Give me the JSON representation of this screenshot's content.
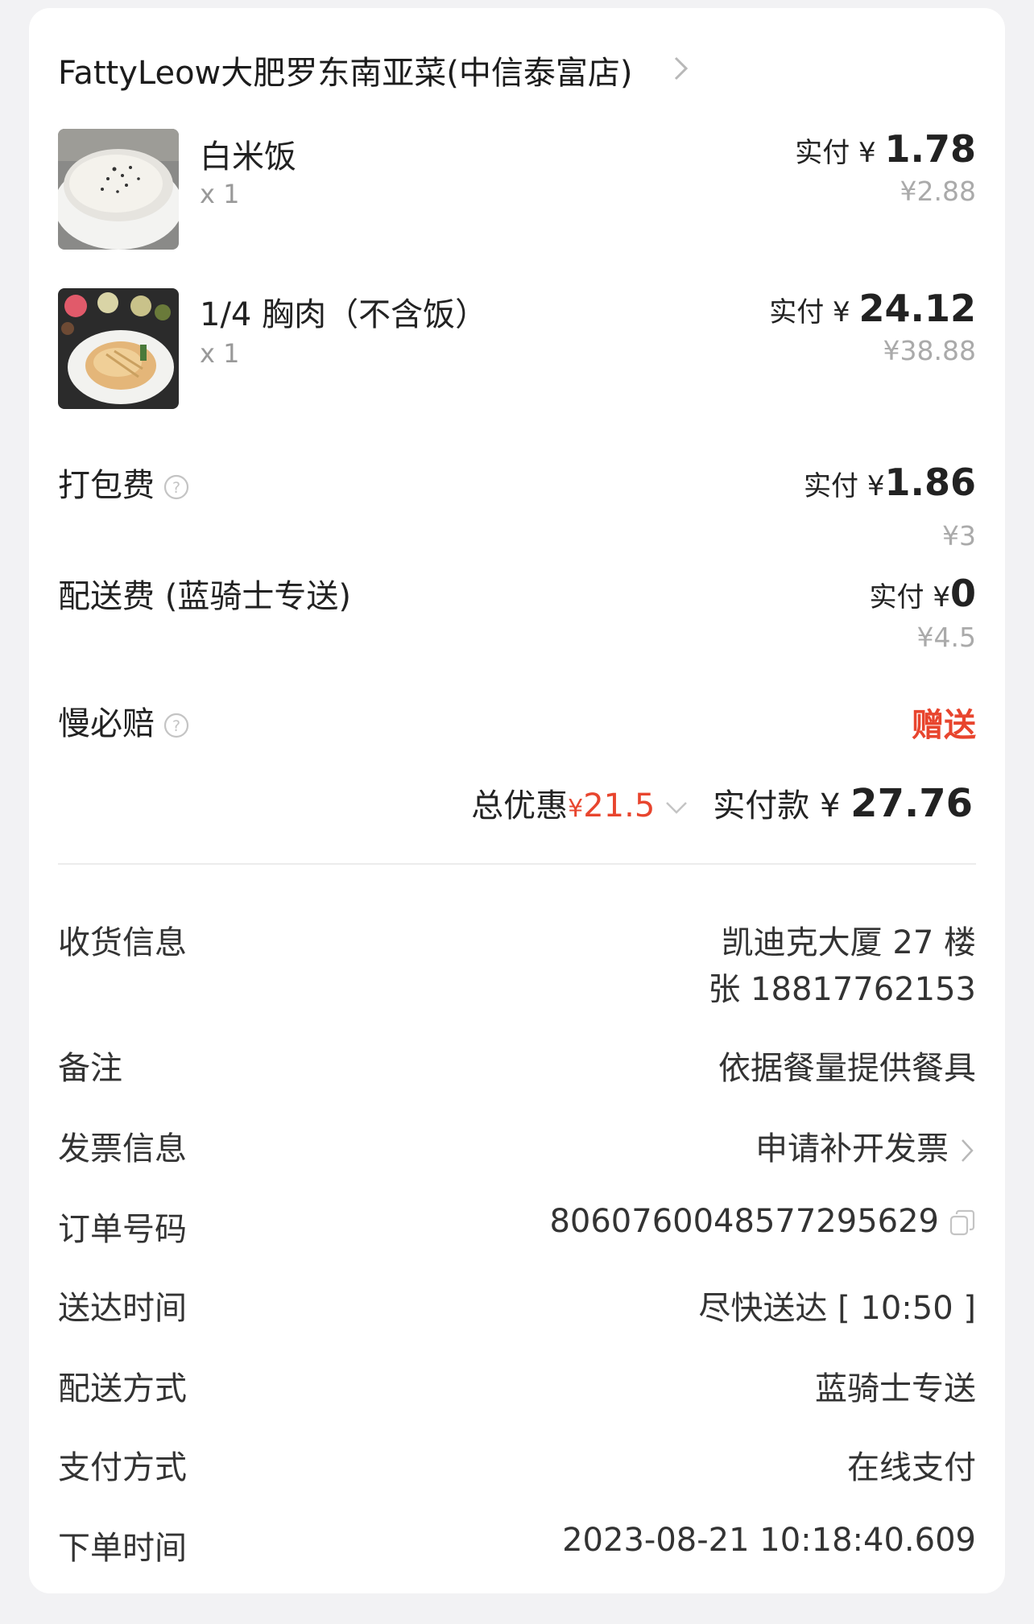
{
  "store": {
    "name": "FattyLeow大肥罗东南亚菜(中信泰富店)"
  },
  "items": [
    {
      "name": "白米饭",
      "qty": "x 1",
      "paid_prefix": "实付 ¥ ",
      "paid_amount": "1.78",
      "original": "¥2.88",
      "image": "rice-photo"
    },
    {
      "name": "1/4 胸肉（不含饭）",
      "qty": "x 1",
      "paid_prefix": "实付 ¥ ",
      "paid_amount": "24.12",
      "original": "¥38.88",
      "image": "chicken-photo"
    }
  ],
  "fees": {
    "packing": {
      "label": "打包费",
      "paid_prefix": "实付 ¥",
      "paid_amount": "1.86",
      "original": "¥3"
    },
    "delivery": {
      "label": "配送费 (蓝骑士专送)",
      "paid_prefix": "实付 ¥",
      "paid_amount": "0",
      "original": "¥4.5"
    },
    "late": {
      "label": "慢必赔",
      "value": "赠送"
    }
  },
  "summary": {
    "discount_label": "总优惠",
    "discount_yen": "¥",
    "discount_amount": "21.5",
    "total_label": "实付款 ¥ ",
    "total_amount": "27.76"
  },
  "info": {
    "address_label": "收货信息",
    "address_line1": "凯迪克大厦 27 楼",
    "address_line2": "张 18817762153",
    "note_label": "备注",
    "note_value": "依据餐量提供餐具",
    "invoice_label": "发票信息",
    "invoice_value": "申请补开发票",
    "order_label": "订单号码",
    "order_value": "8060760048577295629",
    "delivery_time_label": "送达时间",
    "delivery_time_value": "尽快送达 [ 10:50 ]",
    "delivery_method_label": "配送方式",
    "delivery_method_value": "蓝骑士专送",
    "payment_label": "支付方式",
    "payment_value": "在线支付",
    "order_time_label": "下单时间",
    "order_time_value": "2023-08-21 10:18:40.609"
  },
  "colors": {
    "accent_red": "#e8452e",
    "muted": "#aaaaaa",
    "background": "#f2f2f4"
  }
}
